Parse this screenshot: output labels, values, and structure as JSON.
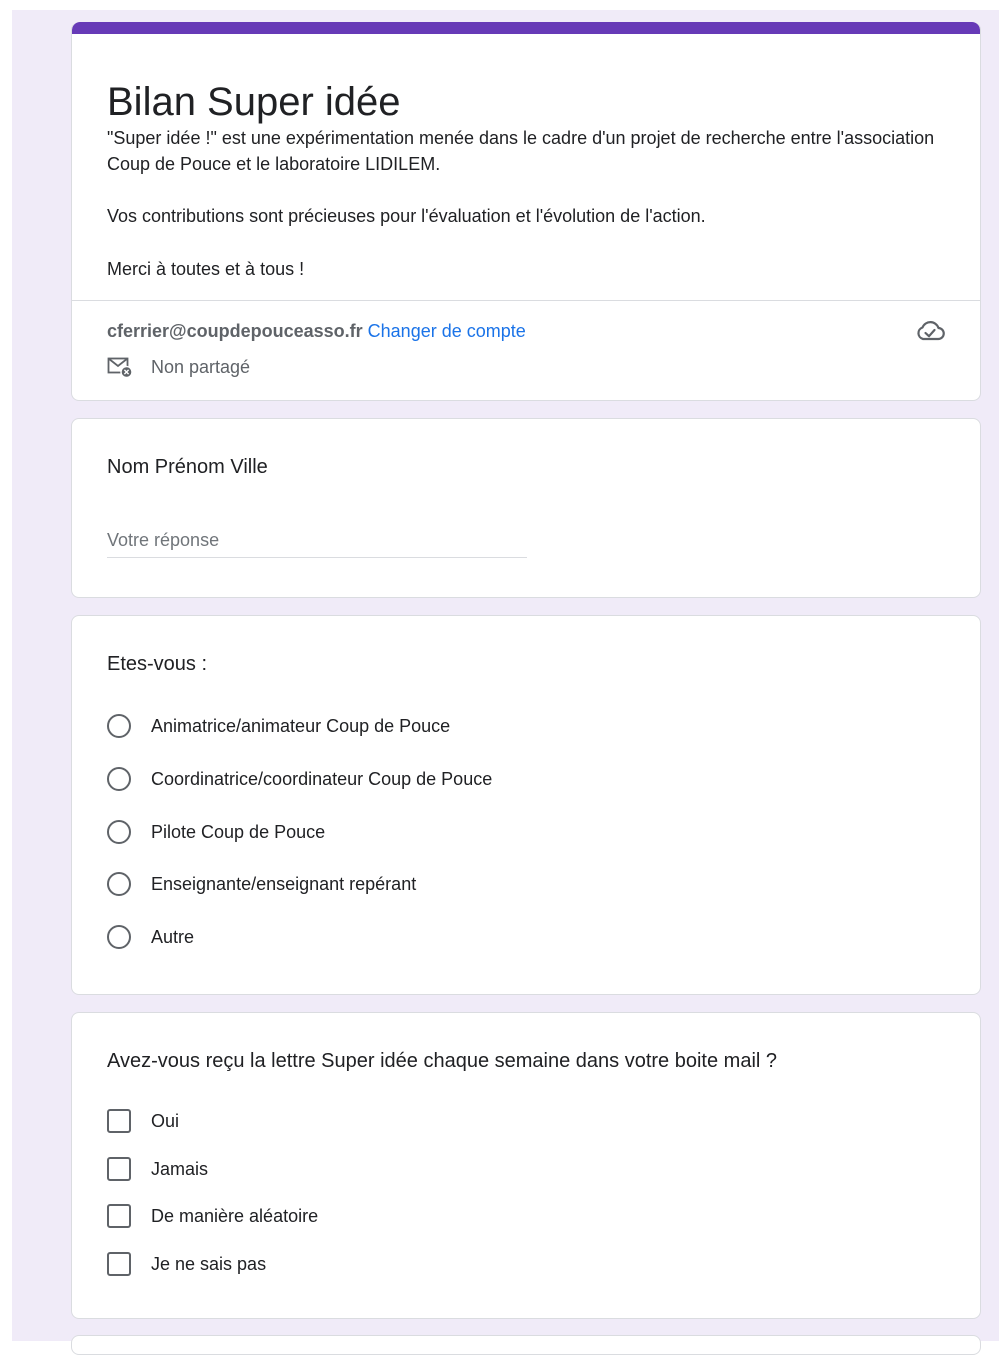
{
  "form": {
    "title": "Bilan Super idée",
    "description": [
      "\"Super idée !\" est une expérimentation menée dans le cadre d'un projet de recherche entre l'association Coup de Pouce et le laboratoire LIDILEM.",
      "Vos contributions sont précieuses pour l'évaluation et l'évolution de l'action.",
      "Merci à toutes et à tous !"
    ],
    "account_email": "cferrier@coupdepouceasso.fr",
    "switch_account_label": "Changer de compte",
    "share_status": "Non partagé",
    "accent_color": "#673ab7",
    "background_color": "#f0ebf8",
    "link_color": "#1a73e8"
  },
  "questions": {
    "name": {
      "title": "Nom Prénom Ville",
      "placeholder": "Votre réponse"
    },
    "role": {
      "title": "Etes-vous :",
      "options": [
        "Animatrice/animateur Coup de Pouce",
        "Coordinatrice/coordinateur Coup de Pouce",
        "Pilote Coup de Pouce",
        "Enseignante/enseignant repérant",
        "Autre"
      ]
    },
    "letter": {
      "title": "Avez-vous reçu la lettre Super idée chaque semaine dans votre boite mail ?",
      "options": [
        "Oui",
        "Jamais",
        "De manière aléatoire",
        "Je ne sais pas"
      ]
    }
  },
  "icons": {
    "cloud": "cloud-check-icon",
    "share": "mail-not-shared-icon"
  }
}
